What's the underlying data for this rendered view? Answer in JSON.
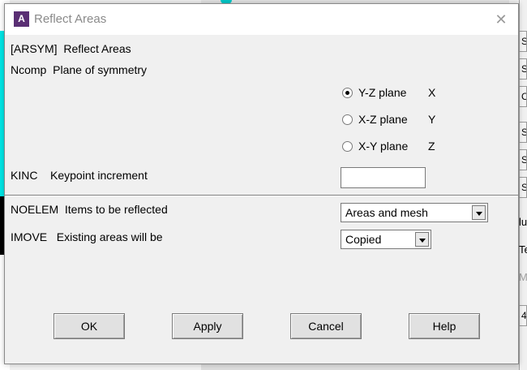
{
  "dialog": {
    "title": "Reflect Areas",
    "icon_letter": "A",
    "close_glyph": "✕",
    "command_line": "[ARSYM]  Reflect Areas",
    "ncomp_label": "Ncomp  Plane of symmetry",
    "planes": [
      {
        "label": "Y-Z plane",
        "axis": "X",
        "checked": true
      },
      {
        "label": "X-Z plane",
        "axis": "Y",
        "checked": false
      },
      {
        "label": "X-Y plane",
        "axis": "Z",
        "checked": false
      }
    ],
    "kinc_label": "KINC    Keypoint increment",
    "kinc_value": "",
    "noelem_label": "NOELEM  Items to be reflected",
    "noelem_value": "Areas and mesh",
    "imove_label": "IMOVE   Existing areas will be",
    "imove_value": "Copied",
    "buttons": {
      "ok": "OK",
      "apply": "Apply",
      "cancel": "Cancel",
      "help": "Help"
    }
  },
  "background": {
    "right_strip_text": [
      "S",
      "S",
      "C",
      "S",
      "S",
      "S",
      "lu",
      "Te",
      "M",
      "4"
    ]
  }
}
